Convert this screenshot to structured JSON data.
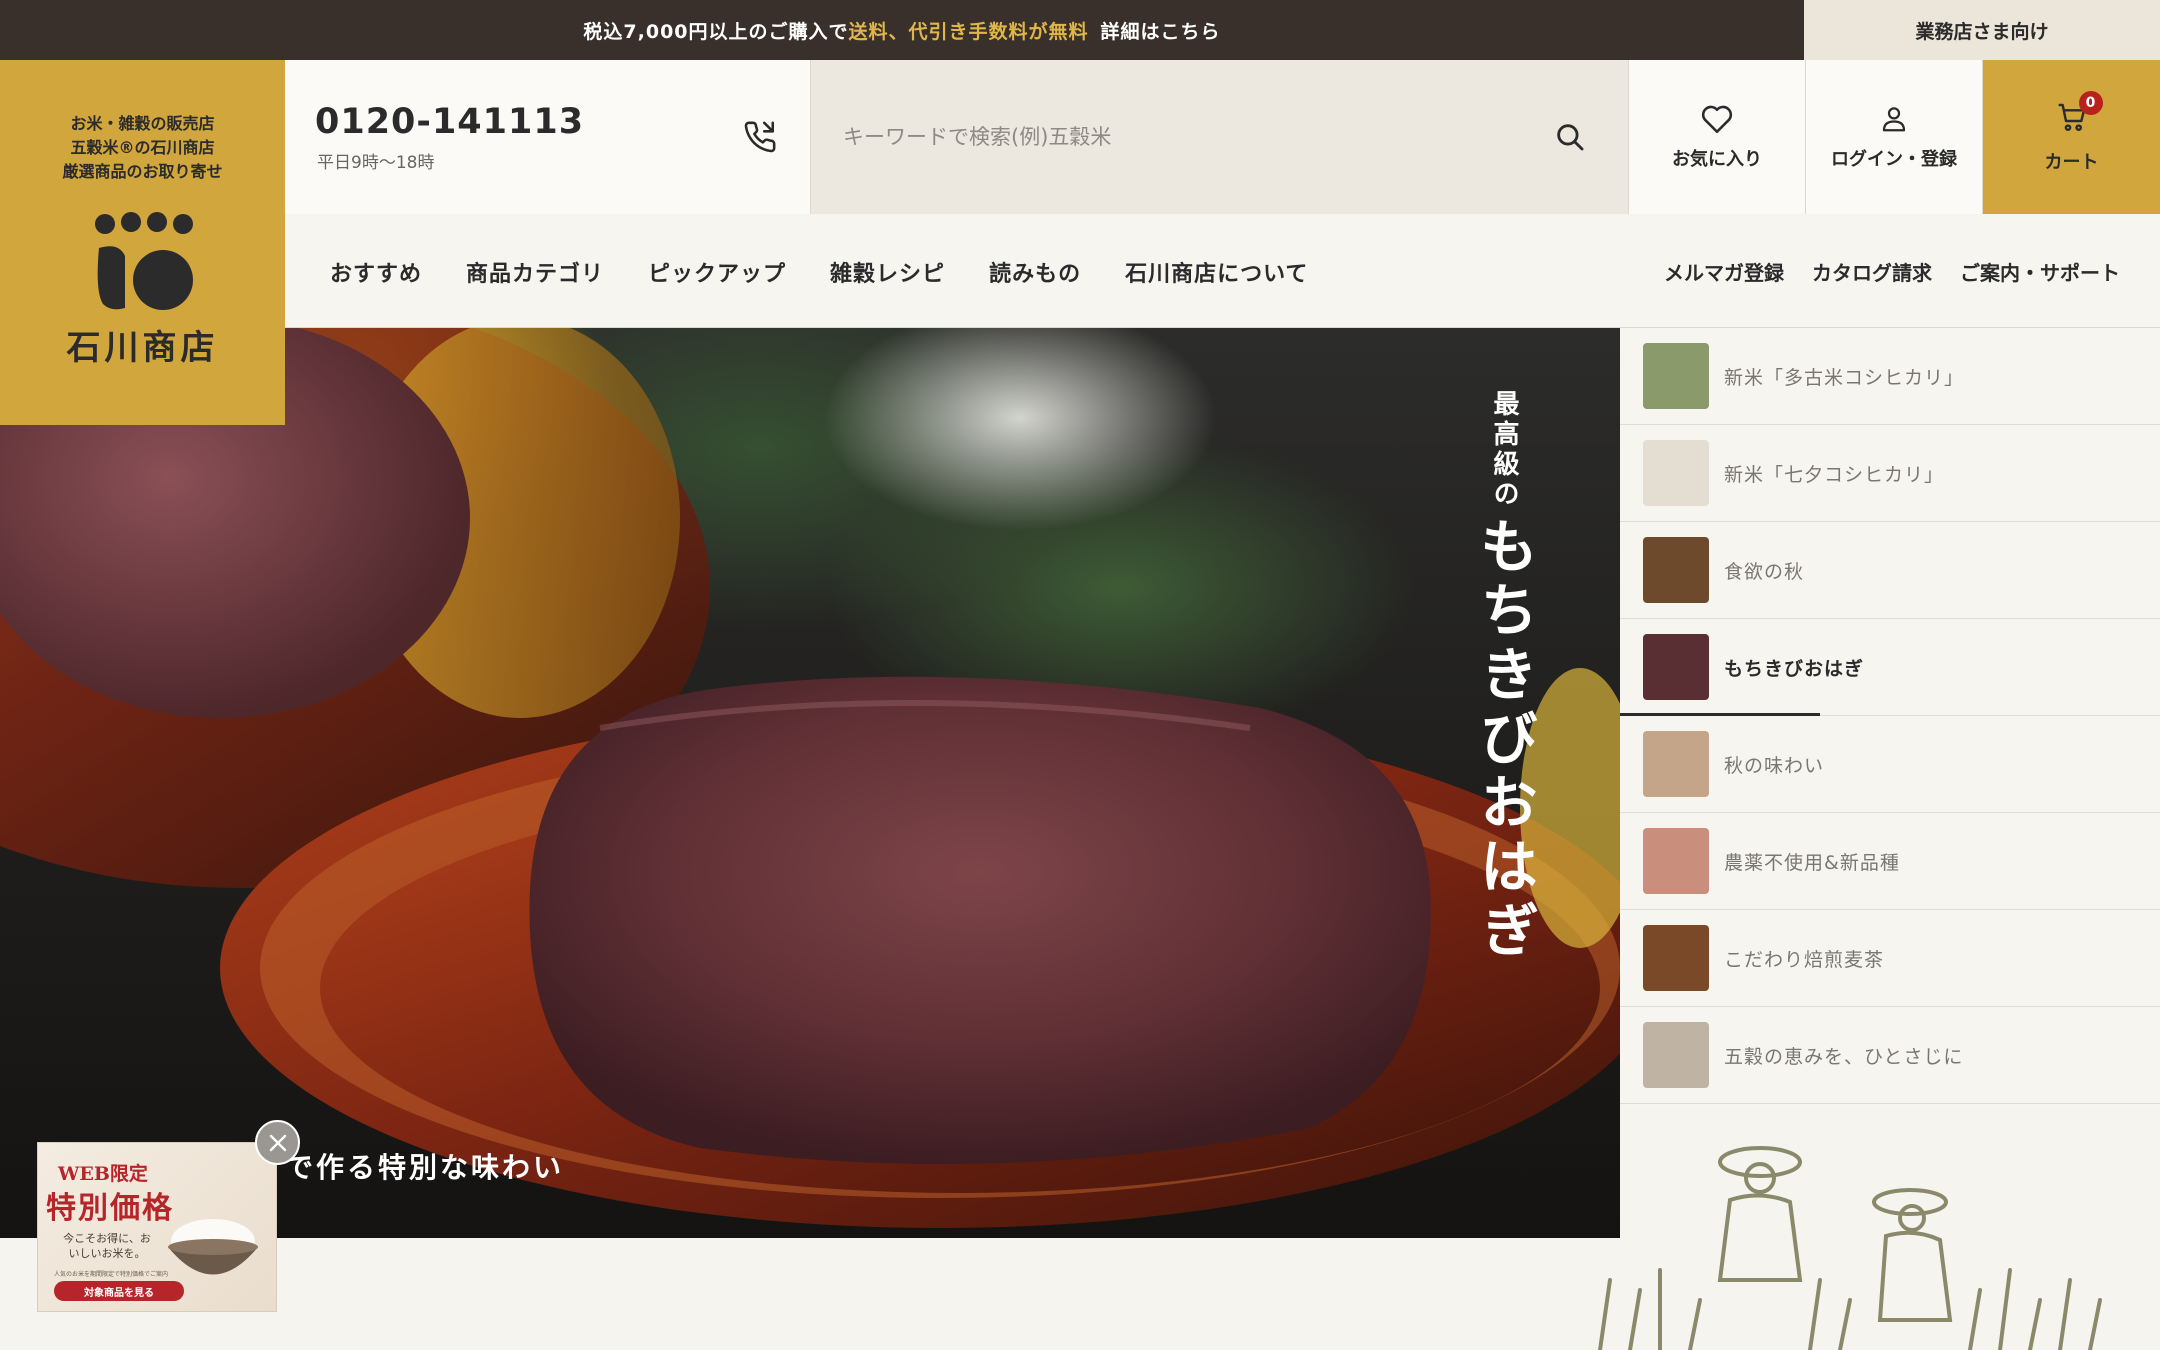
{
  "topbar": {
    "prefix": "税込7,000円以上のご購入で",
    "highlight": "送料、代引き手数料が無料",
    "detail": "詳細はこちら",
    "business_link": "業務店さま向け"
  },
  "logo": {
    "tagline": [
      "お米・雑穀の販売店",
      "五穀米®の石川商店",
      "厳選商品のお取り寄せ"
    ],
    "name": "石川商店"
  },
  "header": {
    "phone_number": "0120-141113",
    "phone_hours": "平日9時〜18時",
    "search_placeholder": "キーワードで検索(例)五穀米",
    "favorites_label": "お気に入り",
    "login_label": "ログイン・登録",
    "cart_label": "カート",
    "cart_count": "0"
  },
  "nav": {
    "main": [
      "おすすめ",
      "商品カテゴリ",
      "ピックアップ",
      "雑穀レシピ",
      "読みもの",
      "石川商店について"
    ],
    "sub": [
      "メルマガ登録",
      "カタログ請求",
      "ご案内・サポート"
    ]
  },
  "hero": {
    "vertical_sub": "最高級の",
    "vertical_main": "もちきびおはぎ",
    "caption": "で作る特別な味わい"
  },
  "slides": [
    {
      "title": "新米「多古米コシヒカリ」",
      "thumb_color": "#8a9a6a"
    },
    {
      "title": "新米「七夕コシヒカリ」",
      "thumb_color": "#e4ded2"
    },
    {
      "title": "食欲の秋",
      "thumb_color": "#6e4a2c"
    },
    {
      "title": "もちきびおはぎ",
      "thumb_color": "#5a2f33"
    },
    {
      "title": "秋の味わい",
      "thumb_color": "#c4a58a"
    },
    {
      "title": "農薬不使用&新品種",
      "thumb_color": "#c98f7c"
    },
    {
      "title": "こだわり焙煎麦茶",
      "thumb_color": "#7a4a28"
    },
    {
      "title": "五穀の恵みを、ひとさじに",
      "thumb_color": "#bfb4a4"
    }
  ],
  "active_slide": "もちきびおはぎ",
  "popup": {
    "web_label": "WEB限定",
    "price_label": "特別価格",
    "copy": "今こそお得に、おいしいお米を。",
    "note": "人気のお米を期間限定で特別価格でご案内",
    "button": "対象商品を見る"
  },
  "colors": {
    "accent": "#d1a73d",
    "topbar": "#3a302b",
    "highlight": "#e0b64a",
    "badge": "#b8221c"
  }
}
